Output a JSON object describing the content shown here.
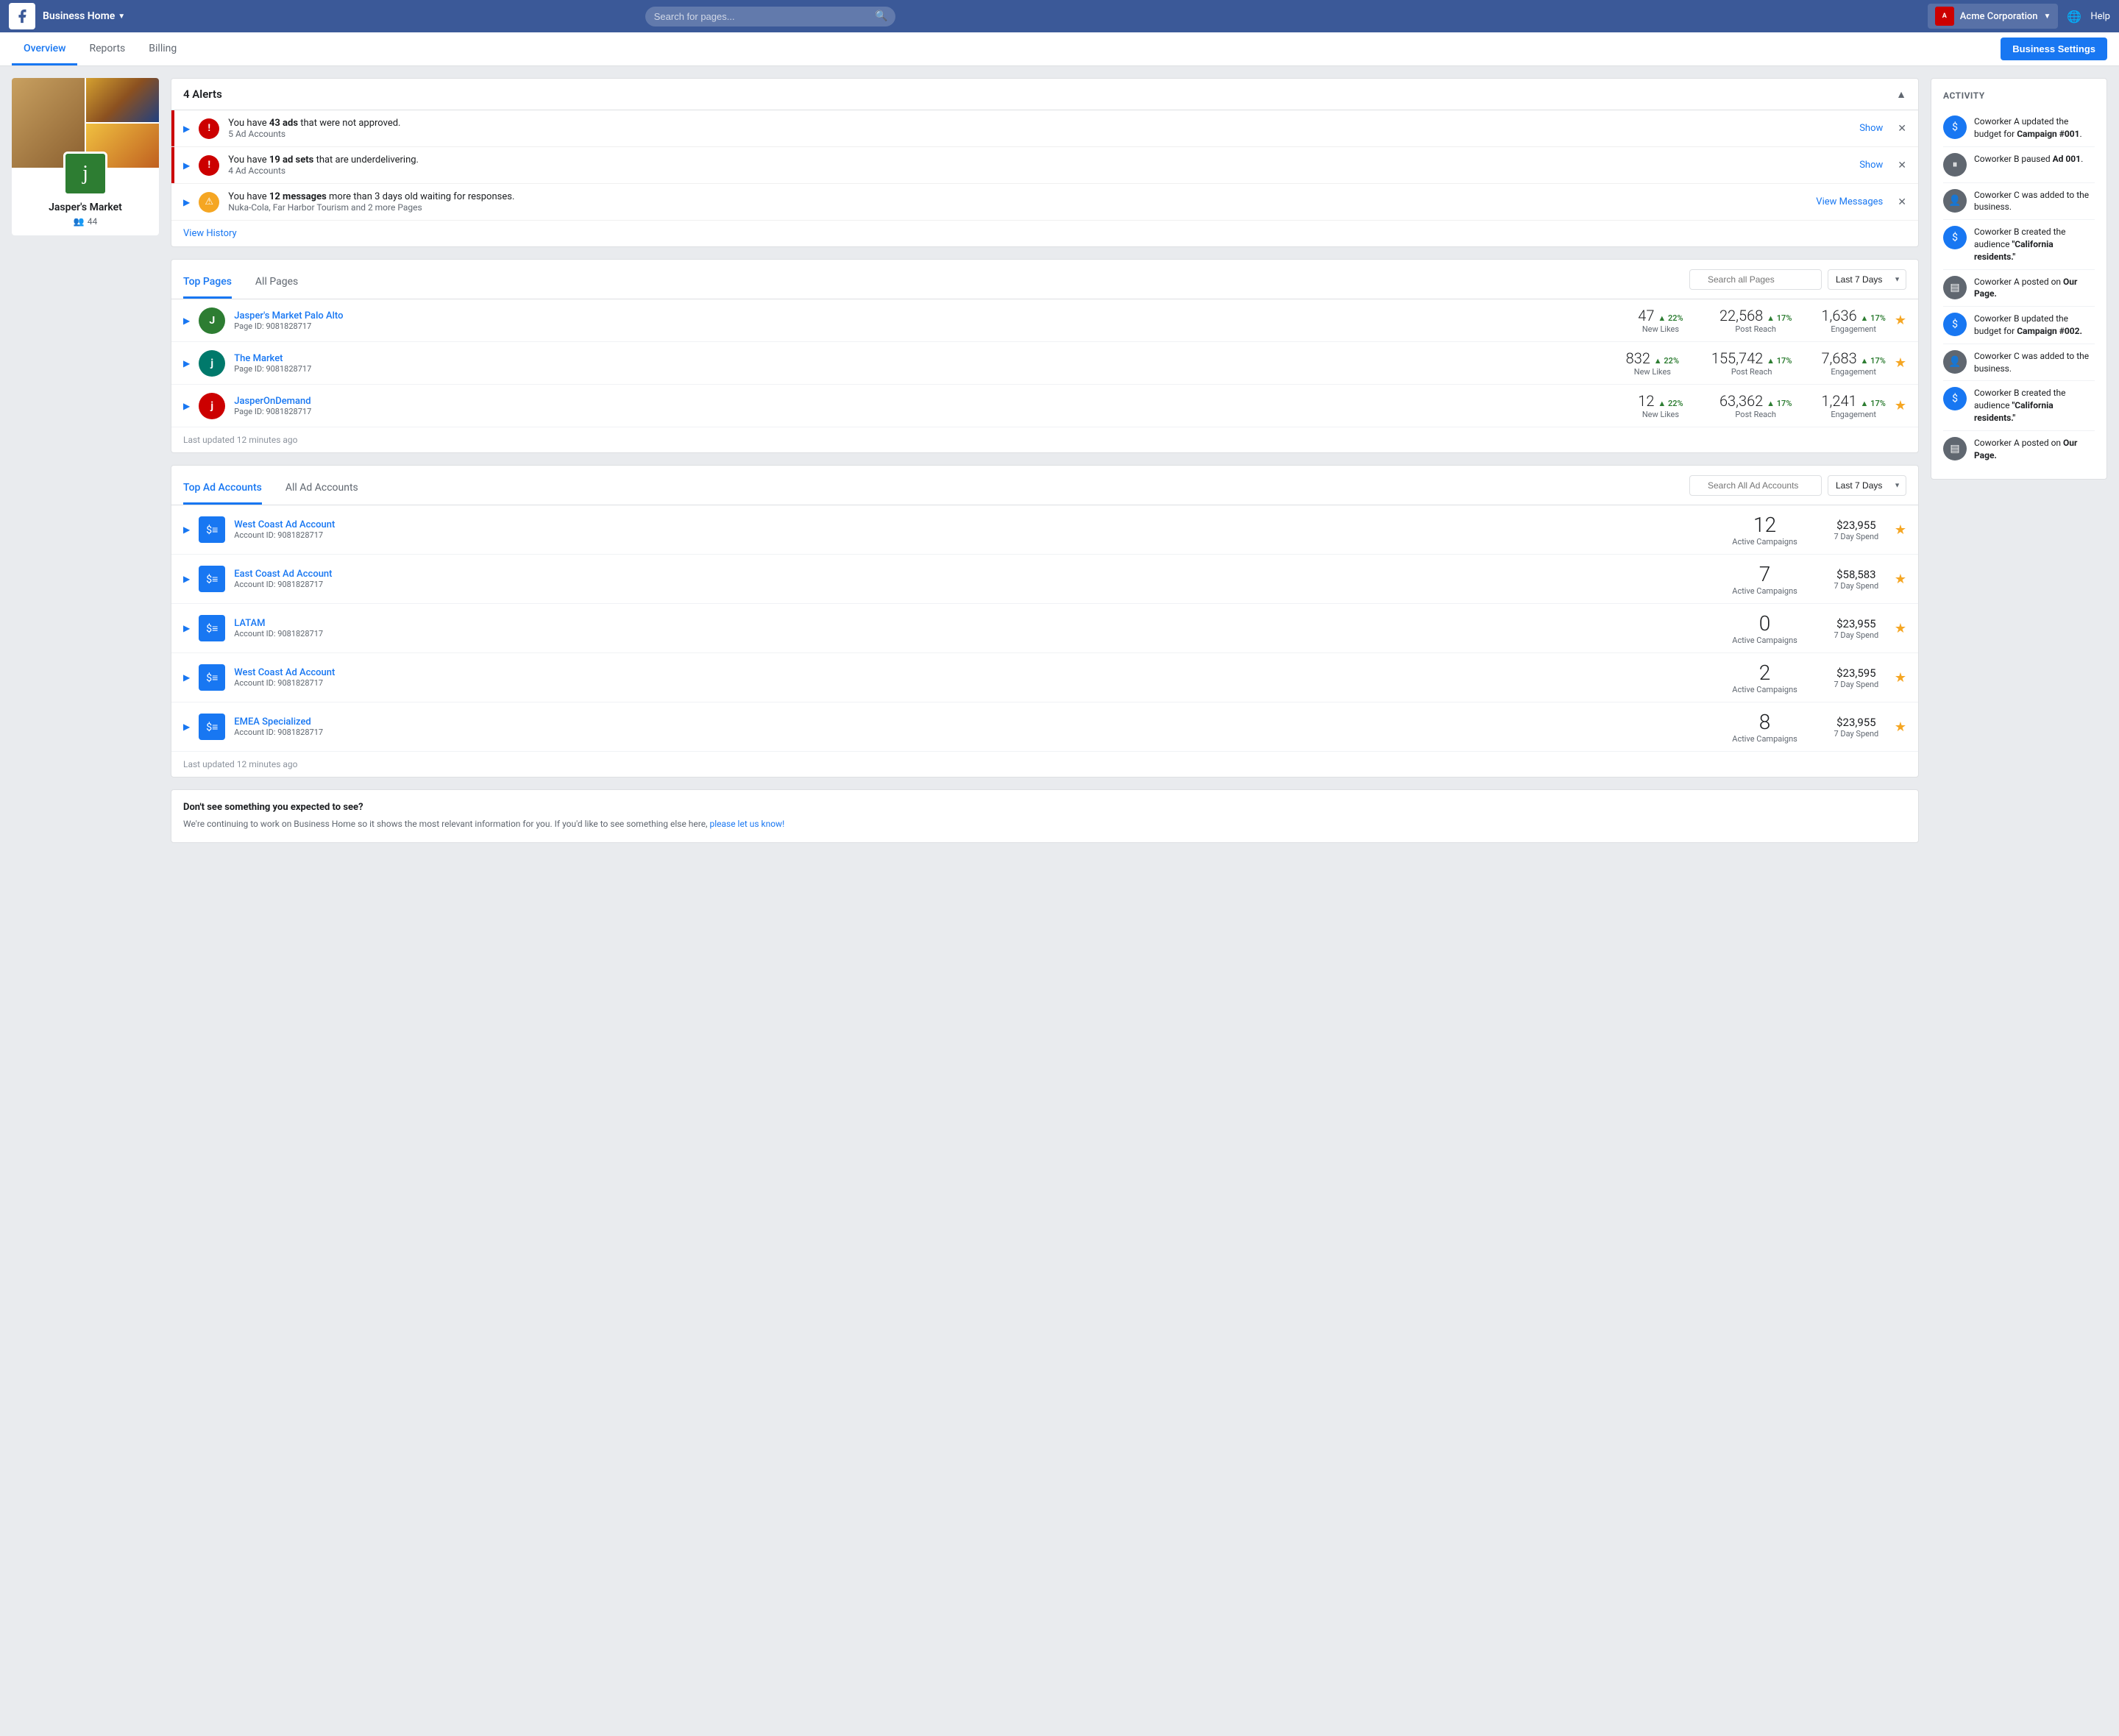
{
  "topnav": {
    "biz_home": "Business Home",
    "search_placeholder": "Search for pages...",
    "acme_name": "Acme Corporation",
    "help": "Help"
  },
  "subnav": {
    "tabs": [
      {
        "label": "Overview",
        "active": true
      },
      {
        "label": "Reports",
        "active": false
      },
      {
        "label": "Billing",
        "active": false
      }
    ],
    "biz_settings": "Business Settings"
  },
  "profile": {
    "name": "Jasper's Market",
    "fans": "44",
    "logo_letter": "j"
  },
  "alerts": {
    "title": "4 Alerts",
    "items": [
      {
        "type": "red",
        "text_pre": "You have",
        "bold": "43 ads",
        "text_post": "that were not approved.",
        "sub": "5 Ad Accounts",
        "action": "Show"
      },
      {
        "type": "red",
        "text_pre": "You have",
        "bold": "19 ad sets",
        "text_post": "that are underdelivering.",
        "sub": "4 Ad Accounts",
        "action": "Show"
      },
      {
        "type": "orange",
        "text_pre": "You have",
        "bold": "12 messages",
        "text_post": "more than 3 days old waiting for responses.",
        "sub": "Nuka-Cola, Far Harbor Tourism and 2 more Pages",
        "action": "View Messages"
      }
    ],
    "view_history": "View History"
  },
  "top_pages": {
    "tab1": "Top Pages",
    "tab2": "All Pages",
    "search_placeholder": "Search all Pages",
    "days_label": "Last 7 Days",
    "pages": [
      {
        "name": "Jasper's Market Palo Alto",
        "id": "Page ID: 9081828717",
        "likes": "47",
        "likes_pct": "▲ 22%",
        "reach": "22,568",
        "reach_pct": "▲ 17%",
        "engagement": "1,636",
        "eng_pct": "▲ 17%",
        "color": "green",
        "letter": "J"
      },
      {
        "name": "The Market",
        "id": "Page ID: 9081828717",
        "likes": "832",
        "likes_pct": "▲ 22%",
        "reach": "155,742",
        "reach_pct": "▲ 17%",
        "engagement": "7,683",
        "eng_pct": "▲ 17%",
        "color": "teal",
        "letter": "j"
      },
      {
        "name": "JasperOnDemand",
        "id": "Page ID: 9081828717",
        "likes": "12",
        "likes_pct": "▲ 22%",
        "reach": "63,362",
        "reach_pct": "▲ 17%",
        "engagement": "1,241",
        "eng_pct": "▲ 17%",
        "color": "red",
        "letter": "j"
      }
    ],
    "last_updated": "Last updated 12 minutes ago"
  },
  "top_ad_accounts": {
    "tab1": "Top Ad Accounts",
    "tab2": "All Ad Accounts",
    "search_placeholder": "Search All Ad Accounts",
    "days_label": "Last 7 Days",
    "accounts": [
      {
        "name": "West Coast Ad Account",
        "id": "Account ID: 9081828717",
        "campaigns": "12",
        "spend": "$23,955"
      },
      {
        "name": "East Coast Ad Account",
        "id": "Account ID: 9081828717",
        "campaigns": "7",
        "spend": "$58,583"
      },
      {
        "name": "LATAM",
        "id": "Account ID: 9081828717",
        "campaigns": "0",
        "spend": "$23,955"
      },
      {
        "name": "West Coast Ad Account",
        "id": "Account ID: 9081828717",
        "campaigns": "2",
        "spend": "$23,595"
      },
      {
        "name": "EMEA Specialized",
        "id": "Account ID: 9081828717",
        "campaigns": "8",
        "spend": "$23,955"
      }
    ],
    "active_campaigns_label": "Active Campaigns",
    "day_spend_label": "7 Day Spend",
    "last_updated": "Last updated 12 minutes ago"
  },
  "activity": {
    "title": "ACTIVITY",
    "items": [
      {
        "icon_type": "blue",
        "icon": "$",
        "text_pre": "Coworker A updated the budget for",
        "bold": "Campaign #001",
        "text_post": "."
      },
      {
        "icon_type": "gray",
        "icon": "⏸",
        "text_pre": "Coworker B paused",
        "bold": "Ad 001",
        "text_post": "."
      },
      {
        "icon_type": "gray",
        "icon": "👤",
        "text_pre": "Coworker C was added to the business.",
        "bold": "",
        "text_post": ""
      },
      {
        "icon_type": "blue",
        "icon": "$",
        "text_pre": "Coworker B created the audience",
        "bold": "\"California residents.\"",
        "text_post": ""
      },
      {
        "icon_type": "gray",
        "icon": "▤",
        "text_pre": "Coworker A posted on",
        "bold": "Our Page.",
        "text_post": ""
      },
      {
        "icon_type": "blue",
        "icon": "$",
        "text_pre": "Coworker B updated the budget for",
        "bold": "Campaign #002.",
        "text_post": ""
      },
      {
        "icon_type": "gray",
        "icon": "👤",
        "text_pre": "Coworker C was added to the business.",
        "bold": "",
        "text_post": ""
      },
      {
        "icon_type": "blue",
        "icon": "$",
        "text_pre": "Coworker B created the audience",
        "bold": "\"California residents.\"",
        "text_post": ""
      },
      {
        "icon_type": "gray",
        "icon": "▤",
        "text_pre": "Coworker A posted on",
        "bold": "Our Page.",
        "text_post": ""
      }
    ]
  },
  "footer": {
    "title": "Don't see something you expected to see?",
    "body": "We're continuing to work on Business Home so it shows the most relevant information for you. If you'd like to see something else here,",
    "link_text": "please let us know!",
    "link_url": "#"
  }
}
